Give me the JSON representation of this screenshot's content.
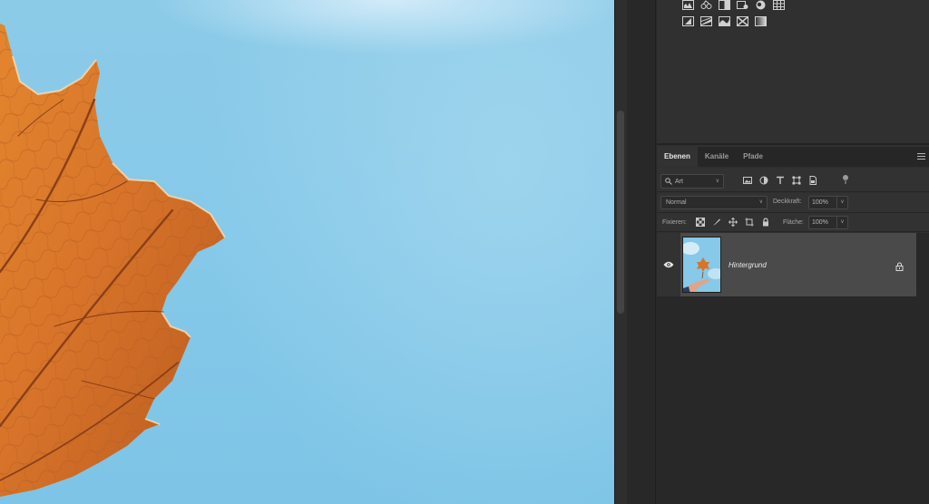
{
  "layers_panel": {
    "tabs": [
      {
        "label": "Ebenen",
        "active": true
      },
      {
        "label": "Kanäle",
        "active": false
      },
      {
        "label": "Pfade",
        "active": false
      }
    ],
    "filter": {
      "kind_placeholder": "Art"
    },
    "blend_mode": "Normal",
    "opacity_label": "Deckkraft:",
    "opacity_value": "100%",
    "lock_label": "Fixieren:",
    "fill_label": "Fläche:",
    "fill_value": "100%",
    "layers": [
      {
        "name": "Hintergrund",
        "visible": true,
        "locked": true,
        "selected": true
      }
    ]
  },
  "colors": {
    "canvas_sky": "#86c9e9",
    "leaf": "#d8742a",
    "panel_bg": "#303030",
    "selected_layer": "#4a4a4a"
  }
}
